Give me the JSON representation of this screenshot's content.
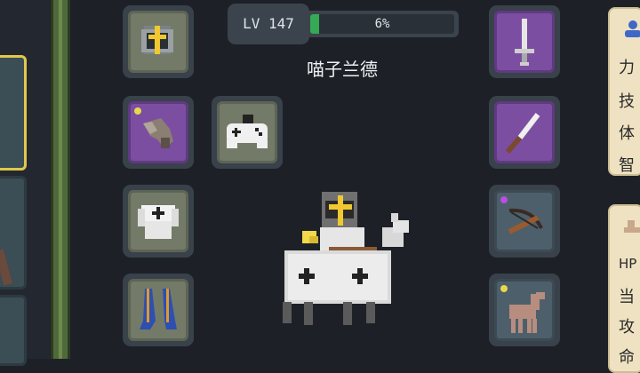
{
  "level": {
    "label": "LV 147",
    "xp_text": "6%",
    "xp_fraction": 0.06
  },
  "hero": {
    "name": "喵子兰德"
  },
  "left_equipment": [
    {
      "name": "helmet",
      "frame": "grey",
      "dot": null
    },
    {
      "name": "gauntlet",
      "frame": "purple",
      "dot": "#e8d84a"
    },
    {
      "name": "armor",
      "frame": "grey",
      "dot": null
    },
    {
      "name": "boots",
      "frame": "grey",
      "dot": null
    }
  ],
  "extra_slot": {
    "name": "gamepad",
    "frame": "grey"
  },
  "right_equipment": [
    {
      "name": "sword",
      "frame": "purple",
      "dot": null
    },
    {
      "name": "dagger",
      "frame": "purple",
      "dot": null
    },
    {
      "name": "crossbow",
      "frame": "slate",
      "dot": "#b84fe0"
    },
    {
      "name": "horse",
      "frame": "slate",
      "dot": "#e8d84a"
    }
  ],
  "attributes_card": {
    "icon": "user-icon",
    "lines": [
      "力",
      "技",
      "体",
      "智"
    ]
  },
  "stats_card": {
    "icon": "scale-icon",
    "lines": [
      "HP",
      "当",
      "攻",
      "命"
    ]
  }
}
